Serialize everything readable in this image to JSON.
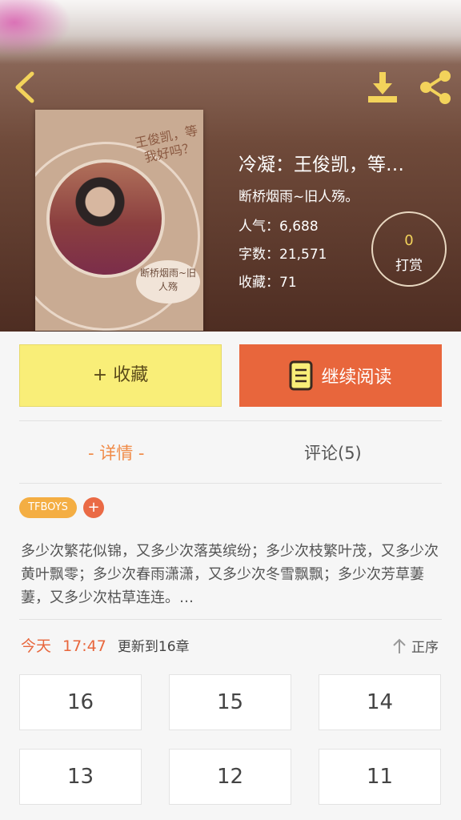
{
  "header": {
    "icons": {
      "back": "chevron-left-icon",
      "download": "download-icon",
      "share": "share-icon"
    }
  },
  "cover": {
    "title": "王俊凯，等我好吗？",
    "author_box": "断桥烟雨~旧人殇"
  },
  "book": {
    "title": "冷凝：王俊凯，等…",
    "author": "断桥烟雨~旧人殇。",
    "popularity": "人气：6,688",
    "word_count": "字数：21,571",
    "favorites": "收藏：71"
  },
  "reward": {
    "count": "0",
    "label": "打赏"
  },
  "actions": {
    "collect": "+ 收藏",
    "read": "继续阅读"
  },
  "tabs": [
    {
      "label": "- 详情 -",
      "active": true
    },
    {
      "label": "评论(5)",
      "active": false
    }
  ],
  "tags": {
    "items": [
      "TFBOYS"
    ],
    "add": "+"
  },
  "summary": "多少次繁花似锦，又多少次落英缤纷；多少次枝繁叶茂，又多少次黄叶飘零；多少次春雨潇潇，又多少次冬雪飘飘；多少次芳草萋萋，又多少次枯草连连。…",
  "update": {
    "day": "今天",
    "time": "17:47",
    "text": "更新到16章"
  },
  "sort": {
    "label": "正序"
  },
  "chapters": [
    "16",
    "15",
    "14",
    "13",
    "12",
    "11"
  ],
  "colors": {
    "accent_orange": "#e8663c",
    "collect_yellow": "#f9ee78",
    "tag_orange": "#f4ae43",
    "icon_yellow": "#f3d35b"
  }
}
